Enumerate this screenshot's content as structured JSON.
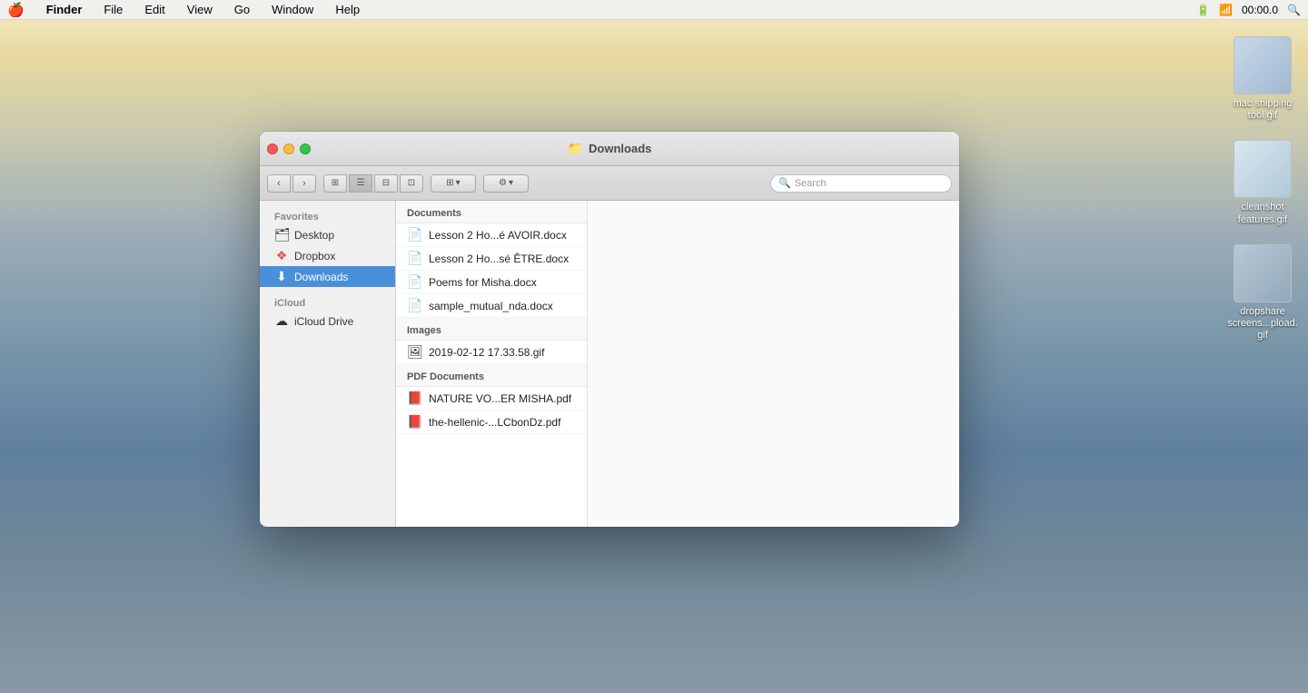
{
  "menubar": {
    "apple": "🍎",
    "items": [
      "Finder",
      "File",
      "Edit",
      "View",
      "Go",
      "Window",
      "Help"
    ],
    "finder_bold": "Finder",
    "right": {
      "time": "00:00.0"
    }
  },
  "desktop": {
    "icons": [
      {
        "label": "mac snipping tool.gif",
        "id": "mac-snipping"
      },
      {
        "label": "cleanshot features.gif",
        "id": "cleanshot"
      },
      {
        "label": "dropshare screens...pload.gif",
        "id": "dropshare"
      }
    ]
  },
  "finder": {
    "title": "Downloads",
    "toolbar": {
      "back": "‹",
      "forward": "›",
      "search_placeholder": "Search",
      "arrange_label": "⊞ ▾",
      "action_label": "⚙ ▾"
    },
    "sidebar": {
      "sections": [
        {
          "label": "Favorites",
          "items": [
            {
              "id": "desktop",
              "icon": "🗂",
              "label": "Desktop"
            },
            {
              "id": "dropbox",
              "icon": "📦",
              "label": "Dropbox"
            },
            {
              "id": "downloads",
              "icon": "⬇",
              "label": "Downloads",
              "active": true
            }
          ]
        },
        {
          "label": "iCloud",
          "items": [
            {
              "id": "icloud-drive",
              "icon": "☁",
              "label": "iCloud Drive"
            }
          ]
        }
      ]
    },
    "files": {
      "groups": [
        {
          "id": "documents",
          "header": "Documents",
          "items": [
            {
              "icon": "📄",
              "name": "Lesson 2 Ho...é AVOIR.docx"
            },
            {
              "icon": "📄",
              "name": "Lesson 2 Ho...sé ÊTRE.docx"
            },
            {
              "icon": "📄",
              "name": "Poems for Misha.docx"
            },
            {
              "icon": "📄",
              "name": "sample_mutual_nda.docx"
            }
          ]
        },
        {
          "id": "images",
          "header": "Images",
          "items": [
            {
              "icon": "🖼",
              "name": "2019-02-12 17.33.58.gif"
            }
          ]
        },
        {
          "id": "pdf-documents",
          "header": "PDF Documents",
          "items": [
            {
              "icon": "📕",
              "name": "NATURE VO...ER MISHA.pdf"
            },
            {
              "icon": "📕",
              "name": "the-hellenic-...LCbonDz.pdf"
            }
          ]
        }
      ]
    }
  }
}
